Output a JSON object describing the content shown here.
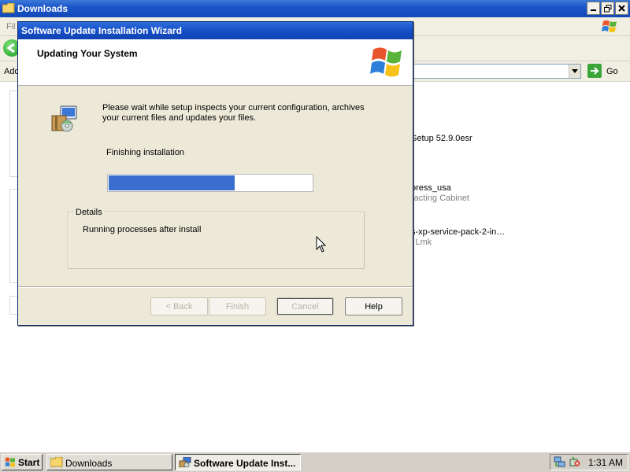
{
  "explorer": {
    "title": "Downloads",
    "menu_first_letter": "Fil",
    "address_label": "Add",
    "go_label": "Go",
    "files": [
      {
        "name": "Setup 52.9.0esr",
        "subtitle": ""
      },
      {
        "name": "oress_usa",
        "subtitle": "racting Cabinet"
      },
      {
        "name": "s-xp-service-pack-2-in…",
        "subtitle": "l Lmk"
      }
    ]
  },
  "dialog": {
    "title": "Software Update Installation Wizard",
    "header_title": "Updating Your System",
    "description": "Please wait while setup inspects your current configuration, archives your current files and updates your files.",
    "status": "Finishing installation",
    "progress": 0.62,
    "details_label": "Details",
    "details_text": "Running processes after install",
    "buttons": {
      "back": "< Back",
      "finish": "Finish",
      "cancel": "Cancel",
      "help": "Help"
    }
  },
  "taskbar": {
    "start_label": "Start",
    "tasks": [
      {
        "label": "Downloads",
        "active": false
      },
      {
        "label": "Software Update Inst...",
        "active": true
      }
    ],
    "clock": "1:31 AM"
  },
  "colors": {
    "titlebar_blue": "#1b56c9",
    "progress_blue": "#3a6fd0",
    "dialog_face": "#ece9d8"
  },
  "icons": [
    "folder-icon",
    "windows-flag-icon",
    "setup-package-icon",
    "back-arrow-icon",
    "go-arrow-icon",
    "mouse-cursor-icon",
    "network-icon",
    "safely-remove-icon"
  ]
}
